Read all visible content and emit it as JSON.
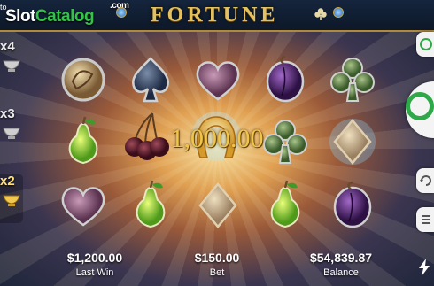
{
  "header": {
    "brand_prefix": "Slot",
    "brand_suffix": "Catalog",
    "brand_domain": ".com",
    "corner_text": "to",
    "game_title": "FORTUNE"
  },
  "multipliers": [
    {
      "label": "x4",
      "active": false
    },
    {
      "label": "x3",
      "active": false
    },
    {
      "label": "x2",
      "active": true
    }
  ],
  "reels": {
    "rows": [
      [
        "coin",
        "spade",
        "heart",
        "plum",
        "club"
      ],
      [
        "pear",
        "cherries",
        "horseshoe",
        "club",
        "diamond"
      ],
      [
        "heart",
        "pear",
        "diamond",
        "pear",
        "plum"
      ]
    ]
  },
  "win_display": "1,000.00",
  "stats": {
    "last_win": {
      "value": "$1,200.00",
      "label": "Last Win"
    },
    "bet": {
      "value": "$150.00",
      "label": "Bet"
    },
    "balance": {
      "value": "$54,839.87",
      "label": "Balance"
    }
  },
  "controls": {
    "top_icon": "help-icon",
    "spin_icon": "spin-icon",
    "auto_icon": "autoplay-icon",
    "menu_icon": "menu-icon",
    "bolt_icon": "turbo-icon"
  },
  "colors": {
    "accent_green": "#2fa84a",
    "gold": "#f0c54a"
  }
}
